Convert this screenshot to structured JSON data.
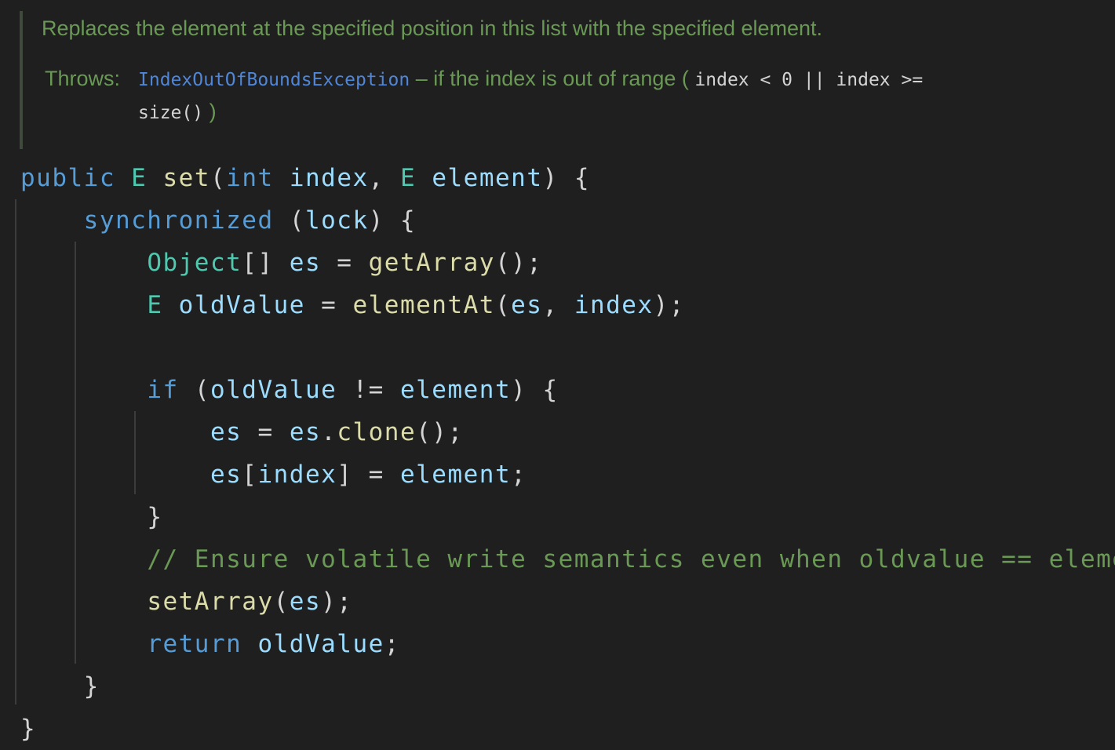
{
  "doc": {
    "summary": "Replaces the element at the specified position in this list with the specified element.",
    "throws_label": "Throws:",
    "exception": "IndexOutOfBoundsException",
    "range_prose": " – if the index is out of range ( ",
    "condition_part1": "index < 0 || index >=",
    "condition_part2": "size()",
    "close_paren": " )"
  },
  "code": {
    "l1": {
      "kw": "public",
      "type": "E",
      "fn": "set",
      "open": "(",
      "kw2": "int",
      "p1": "index",
      "comma": ",",
      "type2": "E",
      "p2": "element",
      "close": ")",
      "brace": "{"
    },
    "l2": {
      "kw": "synchronized",
      "open": "(",
      "var": "lock",
      "close": ")",
      "brace": "{"
    },
    "l3": {
      "type": "Object",
      "brackets": "[]",
      "var": "es",
      "eq": "=",
      "fn": "getArray",
      "call": "();"
    },
    "l4": {
      "type": "E",
      "var": "oldValue",
      "eq": "=",
      "fn": "elementAt",
      "open": "(",
      "a1": "es",
      "comma": ",",
      "a2": "index",
      "close": ");"
    },
    "l6": {
      "kw": "if",
      "open": "(",
      "var": "oldValue",
      "op": "!=",
      "var2": "element",
      "close": ")",
      "brace": "{"
    },
    "l7": {
      "var": "es",
      "eq": "=",
      "var2": "es",
      "dot": ".",
      "fn": "clone",
      "call": "();"
    },
    "l8": {
      "var": "es",
      "lb": "[",
      "idx": "index",
      "rb": "]",
      "eq": "=",
      "var2": "element",
      "semi": ";"
    },
    "l9": {
      "brace": "}"
    },
    "l10": {
      "comment": "// Ensure volatile write semantics even when oldvalue == element"
    },
    "l11": {
      "fn": "setArray",
      "open": "(",
      "var": "es",
      "close": ");"
    },
    "l12": {
      "kw": "return",
      "var": "oldValue",
      "semi": ";"
    },
    "l13": {
      "brace": "}"
    },
    "l14": {
      "brace": "}"
    }
  },
  "colors": {
    "background": "#1f1f1f",
    "keyword": "#569cd6",
    "type": "#4ec9b0",
    "function": "#dcdcaa",
    "variable": "#9cdcfe",
    "comment": "#6a9955",
    "link": "#4f86d8"
  }
}
